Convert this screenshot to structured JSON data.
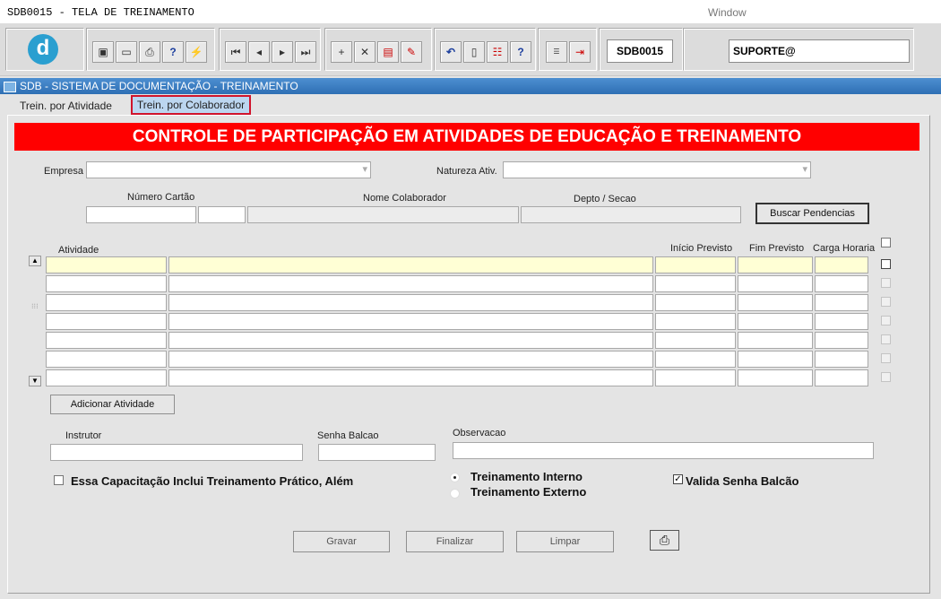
{
  "window": {
    "title": "SDB0015 - TELA DE TREINAMENTO",
    "menu": "Window"
  },
  "toolbar": {
    "form_code": "SDB0015",
    "user": "SUPORTE@"
  },
  "app": {
    "title": "SDB - SISTEMA DE DOCUMENTAÇÃO - TREINAMENTO"
  },
  "tabs": [
    {
      "label": "Trein. por Atividade"
    },
    {
      "label": "Trein. por Colaborador"
    }
  ],
  "header": {
    "title": "CONTROLE DE PARTICIPAÇÃO EM ATIVIDADES DE EDUCAÇÃO E TREINAMENTO"
  },
  "form": {
    "empresa_label": "Empresa",
    "natureza_label": "Natureza Ativ.",
    "numero_cartao_label": "Número Cartão",
    "nome_colaborador_label": "Nome Colaborador",
    "depto_label": "Depto / Secao",
    "buscar_button": "Buscar Pendencias"
  },
  "grid": {
    "col_atividade": "Atividade",
    "col_inicio": "Início Previsto",
    "col_fim": "Fim Previsto",
    "col_carga": "Carga Horaria"
  },
  "actions": {
    "adicionar": "Adicionar Atividade",
    "instrutor_label": "Instrutor",
    "senha_label": "Senha Balcao",
    "observacao_label": "Observacao",
    "pratico_label": "Essa Capacitação Inclui Treinamento Prático, Além",
    "interno_label": "Treinamento Interno",
    "externo_label": "Treinamento Externo",
    "valida_label": "Valida Senha Balcão",
    "gravar": "Gravar",
    "finalizar": "Finalizar",
    "limpar": "Limpar"
  },
  "icons": {
    "logo": "d"
  },
  "colors": {
    "header_bg": "#ff0000",
    "winbar": "#2e6fb4",
    "highlight_row": "#ffffd5",
    "tab_outline": "#d0142c"
  }
}
